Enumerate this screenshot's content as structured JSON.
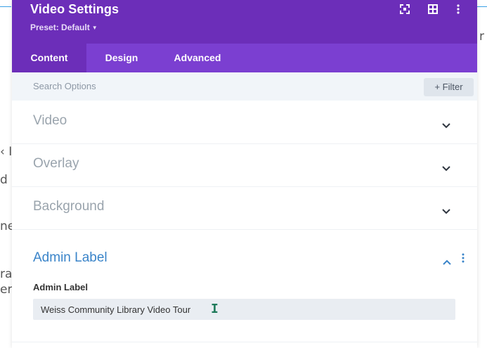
{
  "background": {
    "left_fragments": [
      "‹ I",
      "d",
      "ne",
      "ra",
      "er"
    ],
    "right_fragment": "r"
  },
  "modal": {
    "title": "Video Settings",
    "preset": "Preset: Default",
    "header_icons": [
      "fullscreen-icon",
      "split-view-icon",
      "more-vertical-icon"
    ]
  },
  "tabs": [
    {
      "label": "Content",
      "active": true
    },
    {
      "label": "Design",
      "active": false
    },
    {
      "label": "Advanced",
      "active": false
    }
  ],
  "search": {
    "placeholder": "Search Options",
    "filter_label": "+ Filter"
  },
  "toggles": [
    {
      "title": "Video"
    },
    {
      "title": "Overlay"
    },
    {
      "title": "Background"
    }
  ],
  "admin": {
    "title": "Admin Label",
    "field_label": "Admin Label",
    "field_value": "Weiss Community Library Video Tour"
  },
  "colors": {
    "header": "#6c2eb9",
    "tabs": "#7b3fd1",
    "accent_blue": "#3a84c9"
  }
}
